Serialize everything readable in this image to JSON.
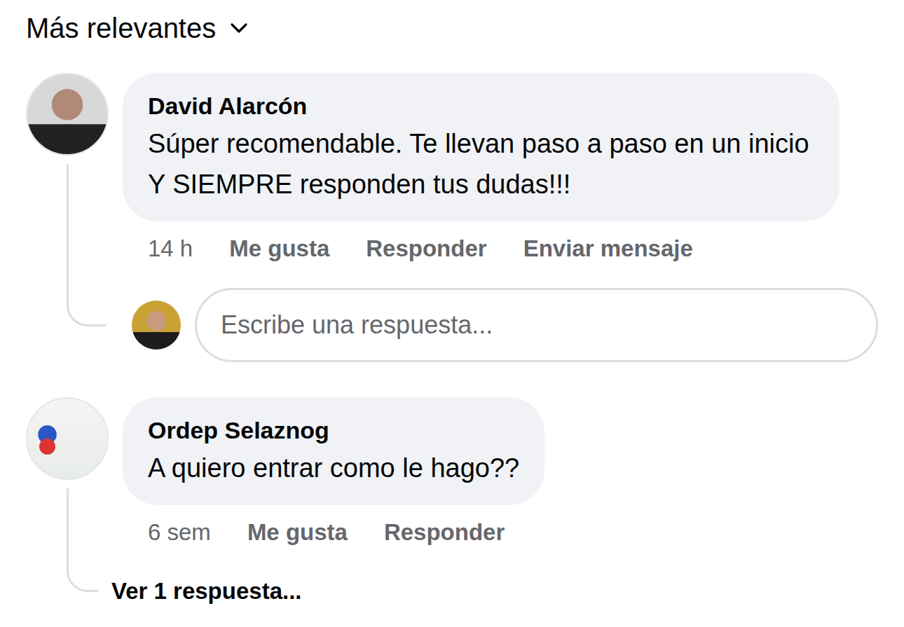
{
  "sort": {
    "label": "Más relevantes"
  },
  "comments": [
    {
      "author": "David Alarcón",
      "text": "Súper recomendable. Te llevan paso a paso en un inicio Y SIEMPRE responden tus dudas!!!",
      "time": "14 h",
      "actions": [
        "Me gusta",
        "Responder",
        "Enviar mensaje"
      ],
      "reply_box": {
        "placeholder": "Escribe una respuesta..."
      }
    },
    {
      "author": "Ordep Selaznog",
      "text": "A quiero entrar como le hago??",
      "time": "6 sem",
      "actions": [
        "Me gusta",
        "Responder"
      ],
      "replies_link": "Ver 1 respuesta..."
    }
  ]
}
